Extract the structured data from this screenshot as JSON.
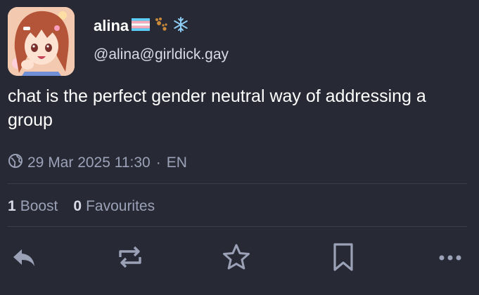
{
  "account": {
    "display_name": "alina",
    "handle": "@alina@girldick.gay",
    "avatar_icon": "anime-girl-avatar",
    "name_emojis": [
      "trans-flag-emoji",
      "paw-prints-emoji",
      "snowflake-emoji"
    ]
  },
  "status": {
    "content": "chat is the perfect gender neutral way of addressing a group",
    "date": "29 Mar 2025 11:30",
    "separator": "·",
    "language": "EN",
    "visibility_icon": "globe-icon"
  },
  "stats": {
    "boosts_count": "1",
    "boosts_label": "Boost",
    "favourites_count": "0",
    "favourites_label": "Favourites"
  },
  "actions": [
    "reply-icon",
    "boost-icon",
    "favourite-icon",
    "bookmark-icon",
    "more-icon"
  ],
  "colors": {
    "background": "#272a35",
    "text": "#ffffff",
    "muted": "#9ba1b6",
    "divider": "#3b3f4d"
  }
}
